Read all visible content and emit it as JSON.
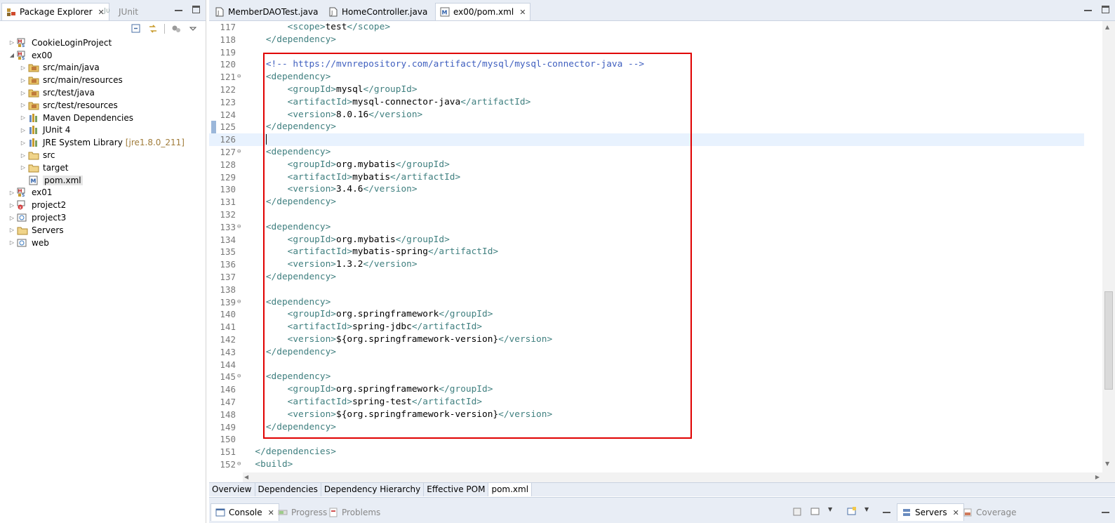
{
  "explorer": {
    "tabs": [
      {
        "label": "Package Explorer",
        "active": true
      },
      {
        "label": "JUnit",
        "active": false
      }
    ],
    "tree": [
      {
        "label": "CookieLoginProject",
        "level": 0,
        "twisty": "collapsed",
        "icon": "maven-project-icon"
      },
      {
        "label": "ex00",
        "level": 0,
        "twisty": "expanded",
        "icon": "maven-project-icon"
      },
      {
        "label": "src/main/java",
        "level": 1,
        "twisty": "collapsed",
        "icon": "source-folder-icon"
      },
      {
        "label": "src/main/resources",
        "level": 1,
        "twisty": "collapsed",
        "icon": "source-folder-icon"
      },
      {
        "label": "src/test/java",
        "level": 1,
        "twisty": "collapsed",
        "icon": "source-folder-icon"
      },
      {
        "label": "src/test/resources",
        "level": 1,
        "twisty": "collapsed",
        "icon": "source-folder-icon"
      },
      {
        "label": "Maven Dependencies",
        "level": 1,
        "twisty": "collapsed",
        "icon": "library-icon"
      },
      {
        "label": "JUnit 4",
        "level": 1,
        "twisty": "collapsed",
        "icon": "library-icon"
      },
      {
        "label": "JRE System Library",
        "suffix": "[jre1.8.0_211]",
        "level": 1,
        "twisty": "collapsed",
        "icon": "library-icon"
      },
      {
        "label": "src",
        "level": 1,
        "twisty": "collapsed",
        "icon": "folder-icon"
      },
      {
        "label": "target",
        "level": 1,
        "twisty": "collapsed",
        "icon": "folder-icon"
      },
      {
        "label": "pom.xml",
        "level": 1,
        "twisty": "none",
        "icon": "pom-file-icon",
        "selected": true
      },
      {
        "label": "ex01",
        "level": 0,
        "twisty": "collapsed",
        "icon": "maven-project-icon"
      },
      {
        "label": "project2",
        "level": 0,
        "twisty": "collapsed",
        "icon": "error-project-icon"
      },
      {
        "label": "project3",
        "level": 0,
        "twisty": "collapsed",
        "icon": "web-project-icon"
      },
      {
        "label": "Servers",
        "level": 0,
        "twisty": "collapsed",
        "icon": "folder-icon"
      },
      {
        "label": "web",
        "level": 0,
        "twisty": "collapsed",
        "icon": "web-project-icon"
      }
    ]
  },
  "editor": {
    "tabs": [
      {
        "label": "MemberDAOTest.java",
        "active": false,
        "icon": "java-file-icon"
      },
      {
        "label": "HomeController.java",
        "active": false,
        "icon": "java-file-icon"
      },
      {
        "label": "ex00/pom.xml",
        "active": true,
        "icon": "pom-file-icon"
      }
    ],
    "lines": [
      {
        "n": "117",
        "html": "        <span class='tag'>&lt;scope&gt;</span>test<span class='tag'>&lt;/scope&gt;</span>"
      },
      {
        "n": "118",
        "html": "    <span class='tag'>&lt;/dependency&gt;</span>"
      },
      {
        "n": "119",
        "html": ""
      },
      {
        "n": "120",
        "html": "    <span class='cm'>&lt;!-- https://mvnrepository.com/artifact/mysql/mysql-connector-java --&gt;</span>"
      },
      {
        "n": "121",
        "fold": true,
        "html": "    <span class='tag'>&lt;dependency&gt;</span>"
      },
      {
        "n": "122",
        "html": "        <span class='tag'>&lt;groupId&gt;</span>mysql<span class='tag'>&lt;/groupId&gt;</span>"
      },
      {
        "n": "123",
        "html": "        <span class='tag'>&lt;artifactId&gt;</span>mysql-connector-java<span class='tag'>&lt;/artifactId&gt;</span>"
      },
      {
        "n": "124",
        "html": "        <span class='tag'>&lt;version&gt;</span>8.0.16<span class='tag'>&lt;/version&gt;</span>"
      },
      {
        "n": "125",
        "mark": true,
        "html": "    <span class='tag'>&lt;/dependency&gt;</span>"
      },
      {
        "n": "126",
        "mark": true,
        "current": true,
        "html": "    <span class='caret'></span>"
      },
      {
        "n": "127",
        "fold": true,
        "html": "    <span class='tag'>&lt;dependency&gt;</span>"
      },
      {
        "n": "128",
        "html": "        <span class='tag'>&lt;groupId&gt;</span>org.mybatis<span class='tag'>&lt;/groupId&gt;</span>"
      },
      {
        "n": "129",
        "html": "        <span class='tag'>&lt;artifactId&gt;</span>mybatis<span class='tag'>&lt;/artifactId&gt;</span>"
      },
      {
        "n": "130",
        "html": "        <span class='tag'>&lt;version&gt;</span>3.4.6<span class='tag'>&lt;/version&gt;</span>"
      },
      {
        "n": "131",
        "html": "    <span class='tag'>&lt;/dependency&gt;</span>"
      },
      {
        "n": "132",
        "html": ""
      },
      {
        "n": "133",
        "fold": true,
        "html": "    <span class='tag'>&lt;dependency&gt;</span>"
      },
      {
        "n": "134",
        "html": "        <span class='tag'>&lt;groupId&gt;</span>org.mybatis<span class='tag'>&lt;/groupId&gt;</span>"
      },
      {
        "n": "135",
        "html": "        <span class='tag'>&lt;artifactId&gt;</span>mybatis-spring<span class='tag'>&lt;/artifactId&gt;</span>"
      },
      {
        "n": "136",
        "html": "        <span class='tag'>&lt;version&gt;</span>1.3.2<span class='tag'>&lt;/version&gt;</span>"
      },
      {
        "n": "137",
        "html": "    <span class='tag'>&lt;/dependency&gt;</span>"
      },
      {
        "n": "138",
        "html": ""
      },
      {
        "n": "139",
        "fold": true,
        "html": "    <span class='tag'>&lt;dependency&gt;</span>"
      },
      {
        "n": "140",
        "html": "        <span class='tag'>&lt;groupId&gt;</span>org.springframework<span class='tag'>&lt;/groupId&gt;</span>"
      },
      {
        "n": "141",
        "html": "        <span class='tag'>&lt;artifactId&gt;</span>spring-jdbc<span class='tag'>&lt;/artifactId&gt;</span>"
      },
      {
        "n": "142",
        "html": "        <span class='tag'>&lt;version&gt;</span>${org.springframework-version}<span class='tag'>&lt;/version&gt;</span>"
      },
      {
        "n": "143",
        "html": "    <span class='tag'>&lt;/dependency&gt;</span>"
      },
      {
        "n": "144",
        "html": ""
      },
      {
        "n": "145",
        "fold": true,
        "html": "    <span class='tag'>&lt;dependency&gt;</span>"
      },
      {
        "n": "146",
        "html": "        <span class='tag'>&lt;groupId&gt;</span>org.springframework<span class='tag'>&lt;/groupId&gt;</span>"
      },
      {
        "n": "147",
        "html": "        <span class='tag'>&lt;artifactId&gt;</span>spring-test<span class='tag'>&lt;/artifactId&gt;</span>"
      },
      {
        "n": "148",
        "html": "        <span class='tag'>&lt;version&gt;</span>${org.springframework-version}<span class='tag'>&lt;/version&gt;</span>"
      },
      {
        "n": "149",
        "html": "    <span class='tag'>&lt;/dependency&gt;</span>"
      },
      {
        "n": "150",
        "html": ""
      },
      {
        "n": "151",
        "html": "  <span class='tag'>&lt;/dependencies&gt;</span>"
      },
      {
        "n": "152",
        "fold": true,
        "html": "  <span class='tag'>&lt;build&gt;</span>"
      }
    ],
    "bottom_tabs": [
      {
        "label": "Overview",
        "active": false
      },
      {
        "label": "Dependencies",
        "active": false
      },
      {
        "label": "Dependency Hierarchy",
        "active": false
      },
      {
        "label": "Effective POM",
        "active": false
      },
      {
        "label": "pom.xml",
        "active": true
      }
    ]
  },
  "console_bar": {
    "tabs": [
      {
        "label": "Console",
        "active": true,
        "closable": true
      },
      {
        "label": "Progress",
        "active": false
      },
      {
        "label": "Problems",
        "active": false
      }
    ],
    "right_tabs": [
      {
        "label": "Servers",
        "active": true,
        "closable": true
      },
      {
        "label": "Coverage",
        "active": false
      }
    ]
  },
  "colors": {
    "xml_tag": "#3f7f7f",
    "comment": "#3f5fbf",
    "highlight_box": "#e00000",
    "current_line": "#e8f2fe"
  }
}
